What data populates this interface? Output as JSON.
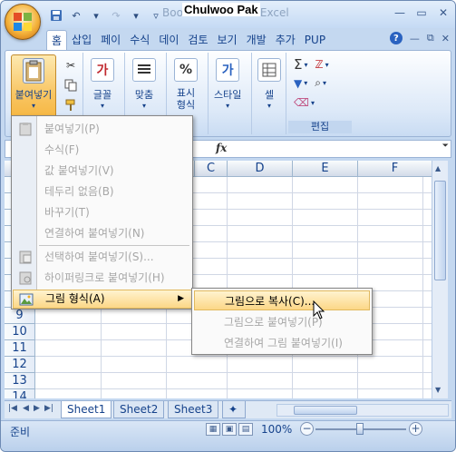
{
  "app": {
    "title_doc": "Book1",
    "title_app": "Microsoft Excel",
    "overlay_name": "Chulwoo Pak"
  },
  "ribbon": {
    "tabs": [
      {
        "label": "홈",
        "active": true
      },
      {
        "label": "삽입"
      },
      {
        "label": "페이"
      },
      {
        "label": "수식"
      },
      {
        "label": "데이"
      },
      {
        "label": "검토"
      },
      {
        "label": "보기"
      },
      {
        "label": "개발"
      },
      {
        "label": "추가"
      },
      {
        "label": "PUP"
      }
    ],
    "paste_label": "붙여넣기",
    "font_label": "글꼴",
    "align_label": "맞춤",
    "number_label_1": "표시",
    "number_label_2": "형식",
    "style_label": "스타일",
    "cells_label": "셀",
    "edit_group_label": "편집",
    "sigma": "Σ",
    "percent": "%"
  },
  "formula_bar": {
    "fx": "fx"
  },
  "grid": {
    "columns": [
      "C",
      "D",
      "E",
      "F"
    ],
    "rows": [
      "9",
      "10",
      "11",
      "12",
      "13",
      "14"
    ]
  },
  "paste_menu": {
    "items": [
      {
        "label": "붙여넣기(P)",
        "enabled": false
      },
      {
        "label": "수식(F)",
        "enabled": false
      },
      {
        "label": "값 붙여넣기(V)",
        "enabled": false
      },
      {
        "label": "테두리 없음(B)",
        "enabled": false
      },
      {
        "label": "바꾸기(T)",
        "enabled": false
      },
      {
        "label": "연결하여 붙여넣기(N)",
        "enabled": false
      },
      {
        "label": "선택하여 붙여넣기(S)...",
        "enabled": false
      },
      {
        "label": "하이퍼링크로 붙여넣기(H)",
        "enabled": false
      },
      {
        "label": "그림 형식(A)",
        "enabled": true,
        "active": true
      }
    ]
  },
  "picture_submenu": {
    "items": [
      {
        "label": "그림으로 복사(C)...",
        "enabled": true,
        "active": true
      },
      {
        "label": "그림으로 붙여넣기(P)",
        "enabled": false
      },
      {
        "label": "연결하여 그림 붙여넣기(I)",
        "enabled": false
      }
    ]
  },
  "sheets": [
    "Sheet1",
    "Sheet2",
    "Sheet3"
  ],
  "status": {
    "ready": "준비",
    "zoom": "100%"
  }
}
